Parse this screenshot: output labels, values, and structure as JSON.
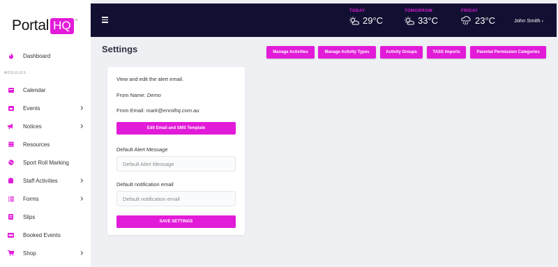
{
  "brand": {
    "name": "Portal",
    "badge": "HQ",
    "tm": "™"
  },
  "sidebar": {
    "modules_label": "MODULES",
    "items": [
      {
        "label": "Dashboard",
        "icon": "fire-icon"
      },
      {
        "label": "Calendar",
        "icon": "calendar-icon"
      },
      {
        "label": "Events",
        "icon": "events-icon",
        "has_children": true
      },
      {
        "label": "Notices",
        "icon": "megaphone-icon",
        "has_children": true
      },
      {
        "label": "Resources",
        "icon": "database-icon"
      },
      {
        "label": "Sport Roll Marking",
        "icon": "ball-icon"
      },
      {
        "label": "Staff Activities",
        "icon": "clipboard-icon",
        "has_children": true
      },
      {
        "label": "Forms",
        "icon": "list-icon",
        "has_children": true
      },
      {
        "label": "Slips",
        "icon": "slip-icon"
      },
      {
        "label": "Booked Events",
        "icon": "ticket-icon"
      },
      {
        "label": "Shop",
        "icon": "cart-icon",
        "has_children": true
      }
    ]
  },
  "topbar": {
    "weather": [
      {
        "day": "TODAY",
        "temp": "29°C",
        "icon": "partly-sunny-icon"
      },
      {
        "day": "TOMORROW",
        "temp": "33°C",
        "icon": "partly-sunny-icon"
      },
      {
        "day": "FRIDAY",
        "temp": "23°C",
        "icon": "rain-cloud-icon"
      }
    ],
    "user_name": "John Smith",
    "user_caret": "▾"
  },
  "page": {
    "title": "Settings",
    "buttons": [
      "Manage Activities",
      "Manage Activity Types",
      "Activity Groups",
      "TASS Imports",
      "Parental Permission Categories"
    ]
  },
  "settings_card": {
    "intro": "View and edit the alert email.",
    "from_name_label": "From Name:",
    "from_name_value": "Demo",
    "from_email_label": "From Email:",
    "from_email_value": "mark@enrolhq.com.au",
    "edit_template_button": "Edit Email and SMS Template",
    "alert_message_label": "Default Alert Message",
    "alert_message_placeholder": "Default Alert Message",
    "alert_message_value": "",
    "notification_email_label": "Default notification email",
    "notification_email_placeholder": "Default notification email",
    "notification_email_value": "",
    "save_button": "SAVE SETTINGS"
  },
  "colors": {
    "accent": "#e21bd8",
    "topbar": "#111032",
    "background": "#eef0f4"
  }
}
